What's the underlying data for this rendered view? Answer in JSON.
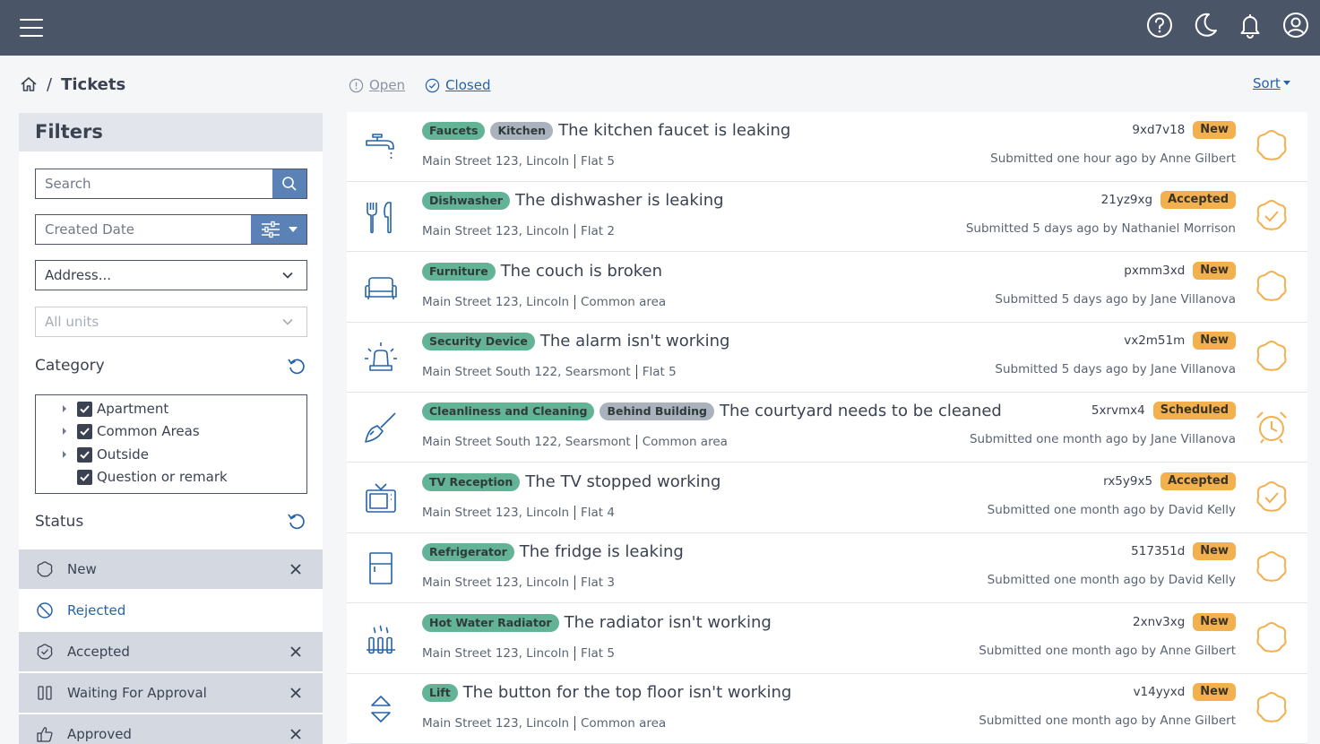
{
  "topbar": {
    "menu_icon": "hamburger-menu-icon",
    "icons": [
      "help-icon",
      "dark-mode-moon-icon",
      "notifications-bell-icon",
      "account-user-icon"
    ]
  },
  "breadcrumb": {
    "home_icon": "home-icon",
    "separator": "/",
    "title": "Tickets"
  },
  "tabs": {
    "open": "Open",
    "closed": "Closed"
  },
  "sort_label": "Sort",
  "filters": {
    "title": "Filters",
    "search_placeholder": "Search",
    "date_placeholder": "Created Date",
    "address_value": "Address...",
    "units_placeholder": "All units",
    "category_title": "Category",
    "categories": [
      {
        "label": "Apartment",
        "expandable": true,
        "checked": true
      },
      {
        "label": "Common Areas",
        "expandable": true,
        "checked": true
      },
      {
        "label": "Outside",
        "expandable": true,
        "checked": true
      },
      {
        "label": "Question or remark",
        "expandable": false,
        "checked": true
      }
    ],
    "status_title": "Status",
    "statuses": [
      {
        "label": "New",
        "selected": true,
        "icon": "cloud-new-icon"
      },
      {
        "label": "Rejected",
        "selected": false,
        "icon": "rejected-circle-icon"
      },
      {
        "label": "Accepted",
        "selected": true,
        "icon": "accepted-check-icon"
      },
      {
        "label": "Waiting For Approval",
        "selected": true,
        "icon": "waiting-columns-icon"
      },
      {
        "label": "Approved",
        "selected": true,
        "icon": "thumbs-up-icon"
      }
    ]
  },
  "tickets": [
    {
      "icon": "faucet-icon",
      "tags": [
        {
          "t": "Faucets",
          "c": "green"
        },
        {
          "t": "Kitchen",
          "c": "gray"
        }
      ],
      "title": "The kitchen faucet is leaking",
      "street": "Main Street 123, Lincoln",
      "unit": "Flat 5",
      "code": "9xd7v18",
      "status": "New",
      "submitted": "Submitted one hour ago by Anne Gilbert"
    },
    {
      "icon": "dishwasher-cutlery-icon",
      "tags": [
        {
          "t": "Dishwasher",
          "c": "green"
        }
      ],
      "title": "The dishwasher is leaking",
      "street": "Main Street 123, Lincoln",
      "unit": "Flat 2",
      "code": "21yz9xg",
      "status": "Accepted",
      "submitted": "Submitted 5 days ago by Nathaniel Morrison"
    },
    {
      "icon": "couch-icon",
      "tags": [
        {
          "t": "Furniture",
          "c": "green"
        }
      ],
      "title": "The couch is broken",
      "street": "Main Street 123, Lincoln",
      "unit": "Common area",
      "code": "pxmm3xd",
      "status": "New",
      "submitted": "Submitted 5 days ago by Jane Villanova"
    },
    {
      "icon": "alarm-siren-icon",
      "tags": [
        {
          "t": "Security Device",
          "c": "green"
        }
      ],
      "title": "The alarm isn't working",
      "street": "Main Street South 122, Searsmont",
      "unit": "Flat 5",
      "code": "vx2m51m",
      "status": "New",
      "submitted": "Submitted 5 days ago by Jane Villanova"
    },
    {
      "icon": "broom-icon",
      "tags": [
        {
          "t": "Cleanliness and Cleaning",
          "c": "green"
        },
        {
          "t": "Behind Building",
          "c": "gray"
        }
      ],
      "title": "The courtyard needs to be cleaned",
      "street": "Main Street South 122, Searsmont",
      "unit": "Common area",
      "code": "5xrvmx4",
      "status": "Scheduled",
      "submitted": "Submitted one month ago by Jane Villanova"
    },
    {
      "icon": "tv-icon",
      "tags": [
        {
          "t": "TV Reception",
          "c": "green"
        }
      ],
      "title": "The TV stopped working",
      "street": "Main Street 123, Lincoln",
      "unit": "Flat 4",
      "code": "rx5y9x5",
      "status": "Accepted",
      "submitted": "Submitted one month ago by David Kelly"
    },
    {
      "icon": "fridge-icon",
      "tags": [
        {
          "t": "Refrigerator",
          "c": "green"
        }
      ],
      "title": "The fridge is leaking",
      "street": "Main Street 123, Lincoln",
      "unit": "Flat 3",
      "code": "517351d",
      "status": "New",
      "submitted": "Submitted one month ago by David Kelly"
    },
    {
      "icon": "radiator-icon",
      "tags": [
        {
          "t": "Hot Water Radiator",
          "c": "green"
        }
      ],
      "title": "The radiator isn't working",
      "street": "Main Street 123, Lincoln",
      "unit": "Flat 5",
      "code": "2xnv3xg",
      "status": "New",
      "submitted": "Submitted one month ago by Anne Gilbert"
    },
    {
      "icon": "lift-arrows-icon",
      "tags": [
        {
          "t": "Lift",
          "c": "green"
        }
      ],
      "title": "The button for the top floor isn't working",
      "street": "Main Street 123, Lincoln",
      "unit": "Common area",
      "code": "v14yyxd",
      "status": "New",
      "submitted": "Submitted one month ago by Anne Gilbert"
    }
  ],
  "colors": {
    "topbar": "#4b5568",
    "accent": "#5b82b7",
    "link": "#2563a9",
    "tag_green": "#63b396",
    "tag_gray": "#aab2bd",
    "badge": "#f2b04e",
    "status_icon": "#f2b04e"
  }
}
